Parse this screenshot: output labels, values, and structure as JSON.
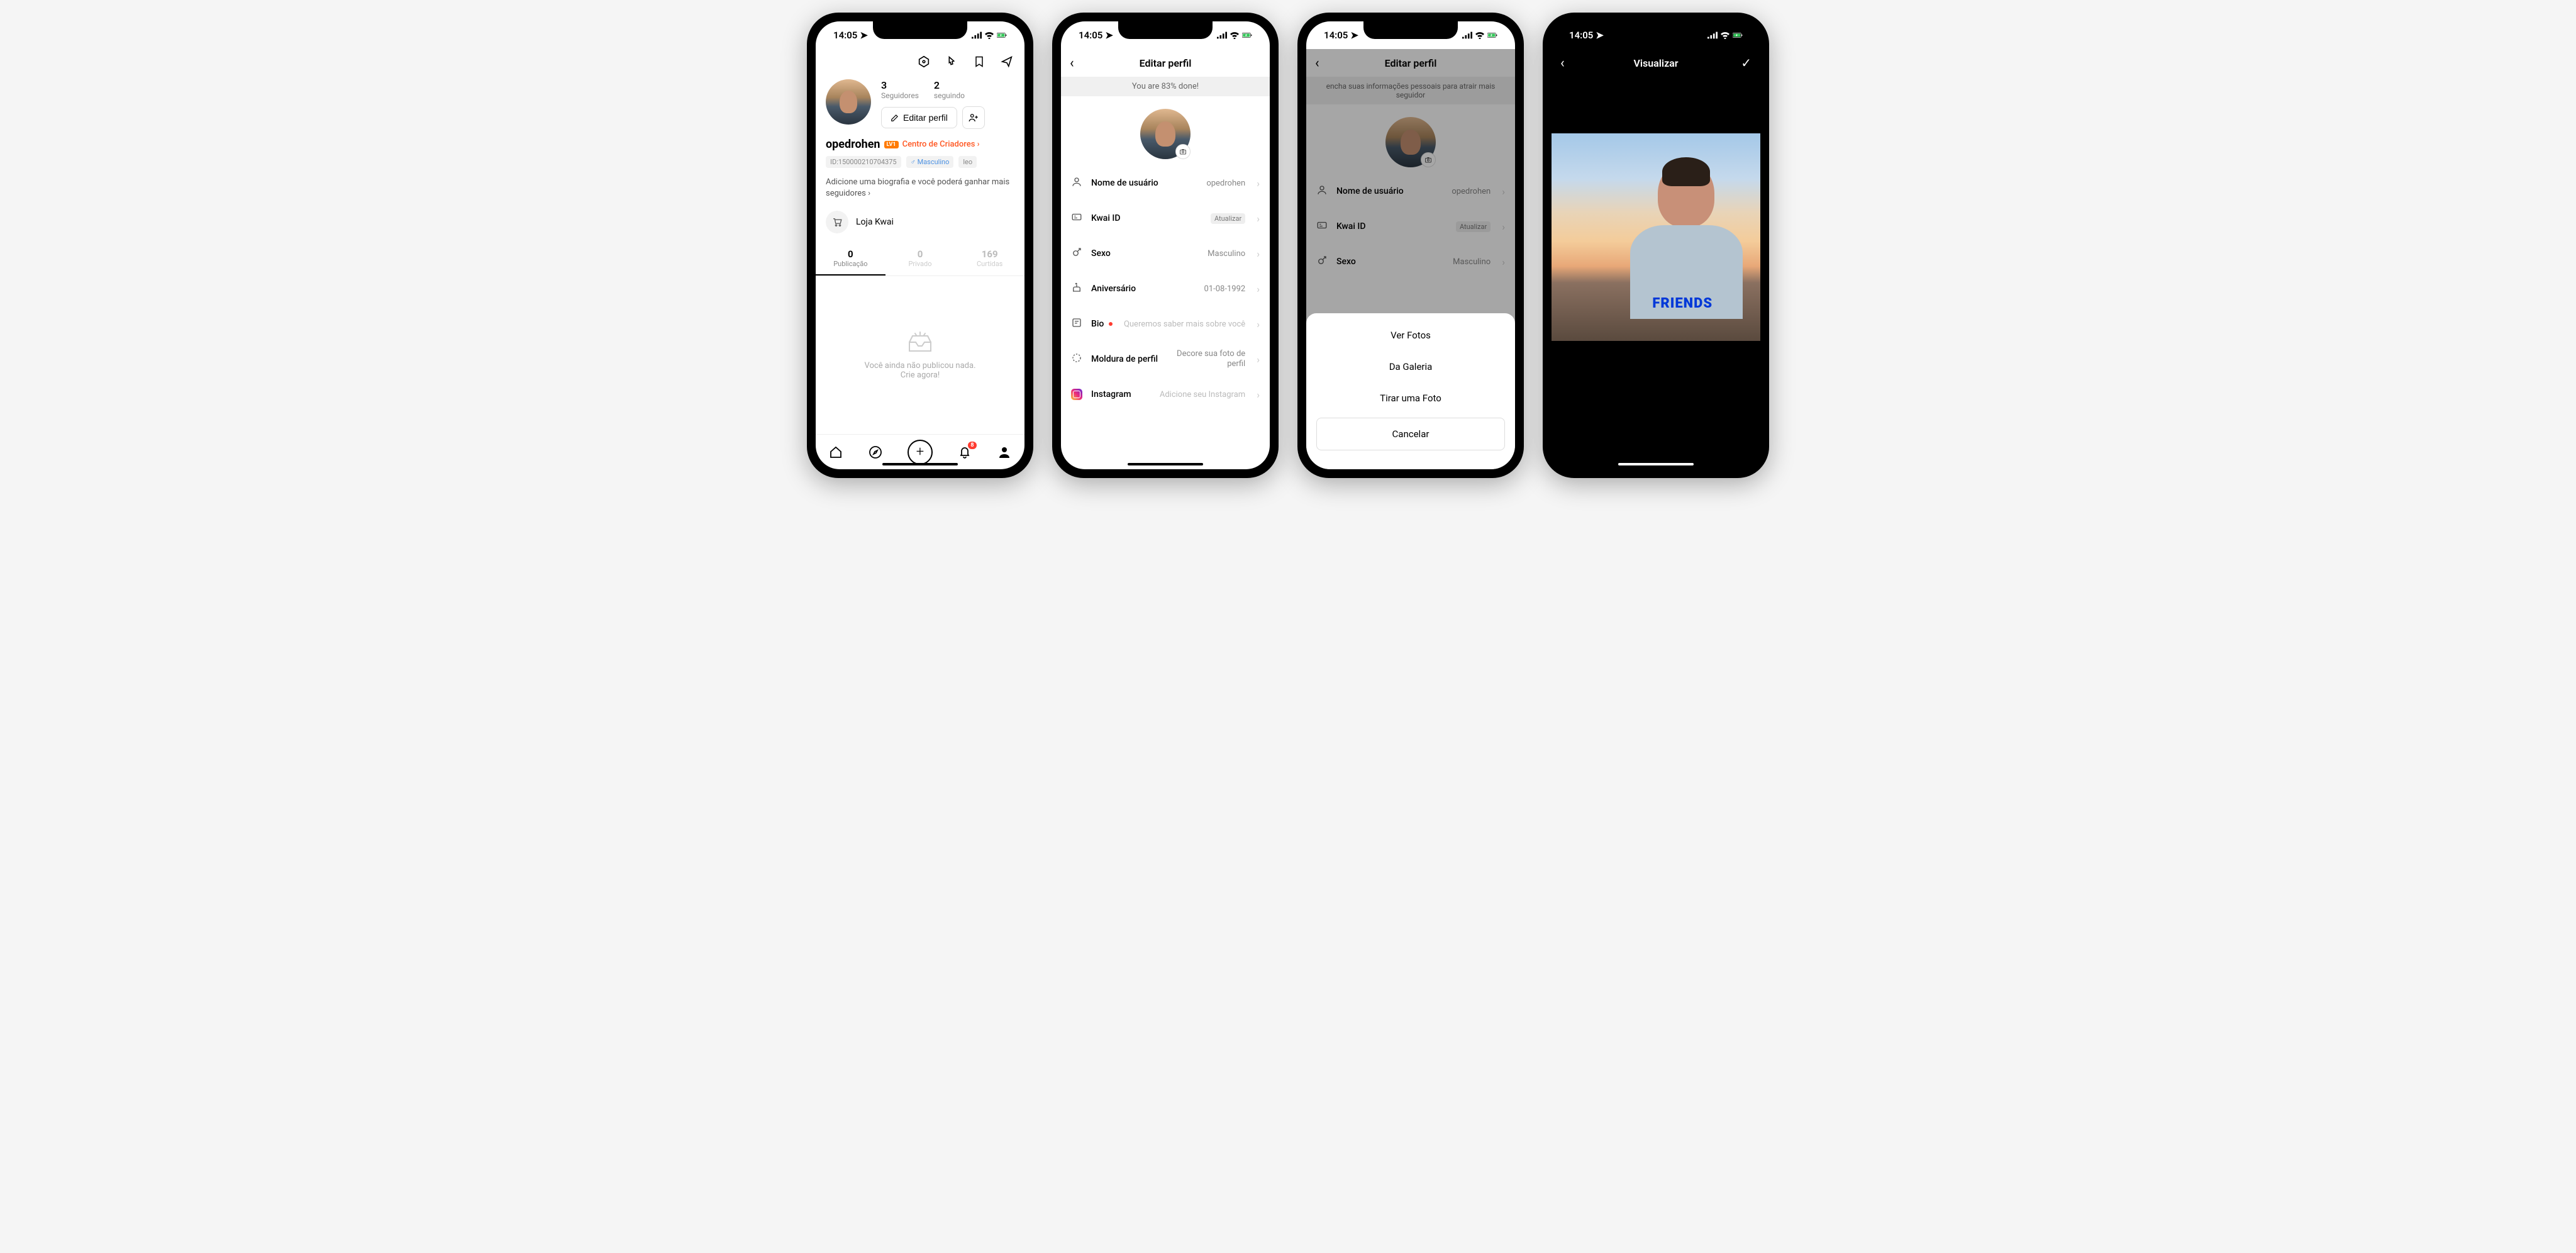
{
  "status": {
    "time": "14:05"
  },
  "screen1": {
    "stats": {
      "followers_n": "3",
      "followers_l": "Seguidores",
      "following_n": "2",
      "following_l": "seguindo"
    },
    "edit_btn": "Editar perfil",
    "username": "opedrohen",
    "lv_badge": "LV1",
    "creators_link": "Centro de Criadores ›",
    "id_tag": "ID:150000210704375",
    "gender_tag": "♂ Masculino",
    "zodiac_tag": "leo",
    "bio_prompt": "Adicione uma biografia e você poderá ganhar mais seguidores ›",
    "shop": "Loja Kwai",
    "tabs": {
      "posts_n": "0",
      "posts_l": "Publicação",
      "private_n": "0",
      "private_l": "Privado",
      "likes_n": "169",
      "likes_l": "Curtidas"
    },
    "empty1": "Você ainda não publicou nada.",
    "empty2": "Crie agora!",
    "notif_badge": "8"
  },
  "screen2": {
    "title": "Editar perfil",
    "banner": "You are 83% done!",
    "rows": {
      "username_l": "Nome de usuário",
      "username_v": "opedrohen",
      "kwaiid_l": "Kwai ID",
      "kwaiid_v": "Atualizar",
      "sex_l": "Sexo",
      "sex_v": "Masculino",
      "bday_l": "Aniversário",
      "bday_v": "01-08-1992",
      "bio_l": "Bio",
      "bio_v": "Queremos saber mais sobre você",
      "frame_l": "Moldura de perfil",
      "frame_v": "Decore sua foto de perfil",
      "ig_l": "Instagram",
      "ig_v": "Adicione seu Instagram"
    }
  },
  "screen3": {
    "title": "Editar perfil",
    "banner": "encha suas informações pessoais para atrair mais seguidor",
    "sheet": {
      "opt1": "Ver Fotos",
      "opt2": "Da Galeria",
      "opt3": "Tirar uma Foto",
      "cancel": "Cancelar"
    }
  },
  "screen4": {
    "title": "Visualizar",
    "shirt": "FRIENDS"
  }
}
